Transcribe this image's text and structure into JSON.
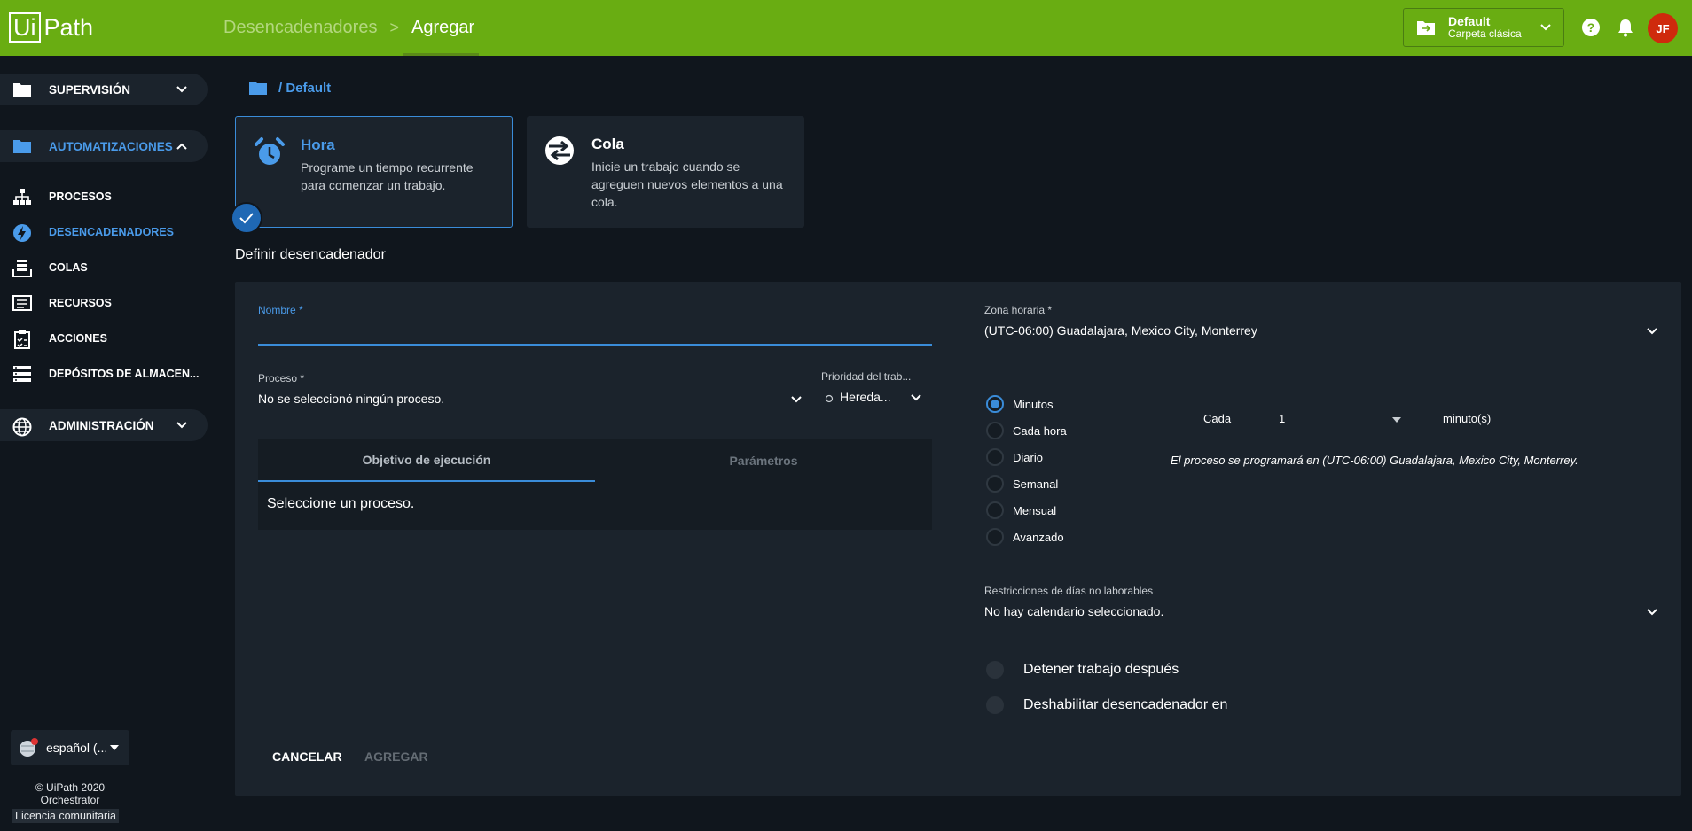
{
  "header": {
    "logo_ui": "Ui",
    "logo_path": "Path",
    "breadcrumb_prev": "Desencadenadores",
    "breadcrumb_sep": ">",
    "breadcrumb_current": "Agregar",
    "folder_name": "Default",
    "folder_type": "Carpeta clásica",
    "avatar_initials": "JF",
    "accent": "#69ad12"
  },
  "sidebar": {
    "groups": {
      "supervision": "SUPERVISIÓN",
      "automatizaciones": "AUTOMATIZACIONES",
      "administracion": "ADMINISTRACIÓN"
    },
    "items": [
      {
        "label": "PROCESOS",
        "icon": "sitemap-icon"
      },
      {
        "label": "DESENCADENADORES",
        "icon": "lightning-icon"
      },
      {
        "label": "COLAS",
        "icon": "queue-icon"
      },
      {
        "label": "RECURSOS",
        "icon": "assets-icon"
      },
      {
        "label": "ACCIONES",
        "icon": "clipboard-icon"
      },
      {
        "label": "DEPÓSITOS DE ALMACEN...",
        "icon": "storage-icon"
      }
    ],
    "language": "español (...",
    "copyright_line1": "© UiPath 2020",
    "copyright_line2": "Orchestrator",
    "license": "Licencia comunitaria"
  },
  "main": {
    "folder_path": "/ Default",
    "cards": {
      "time": {
        "title": "Hora",
        "desc": "Programe un tiempo recurrente para comenzar un trabajo."
      },
      "queue": {
        "title": "Cola",
        "desc": "Inicie un trabajo cuando se agreguen nuevos elementos a una cola."
      }
    },
    "section_title": "Definir desencadenador",
    "form": {
      "name_label": "Nombre *",
      "name_value": "",
      "process_label": "Proceso *",
      "process_value": "No se seleccionó ningún proceso.",
      "priority_label": "Prioridad del trab...",
      "priority_value": "Hereda...",
      "tabs": [
        "Objetivo de ejecución",
        "Parámetros"
      ],
      "tab_content": "Seleccione un proceso.",
      "cancel": "CANCELAR",
      "add": "AGREGAR",
      "timezone_label": "Zona horaria *",
      "timezone_value": "(UTC-06:00) Guadalajara, Mexico City, Monterrey",
      "frequency_options": [
        "Minutos",
        "Cada hora",
        "Diario",
        "Semanal",
        "Mensual",
        "Avanzado"
      ],
      "frequency_selected": "Minutos",
      "every_label": "Cada",
      "every_value": "1",
      "every_unit": "minuto(s)",
      "schedule_note": "El proceso se programará en (UTC-06:00) Guadalajara, Mexico City, Monterrey.",
      "nonwork_label": "Restricciones de días no laborables",
      "nonwork_value": "No hay calendario seleccionado.",
      "stop_job": "Detener trabajo después",
      "disable_trigger": "Deshabilitar desencadenador en"
    }
  }
}
